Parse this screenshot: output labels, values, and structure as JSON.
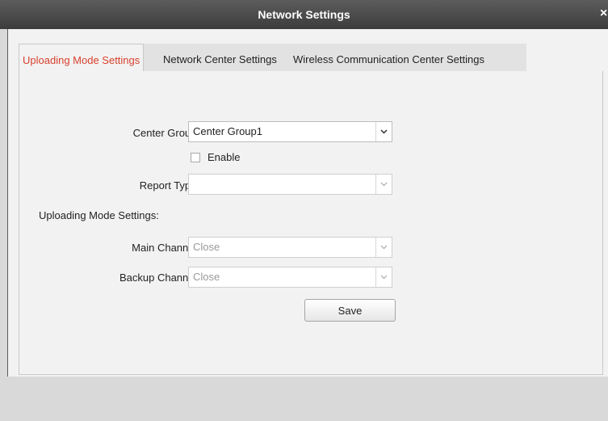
{
  "window": {
    "title": "Network Settings",
    "close_glyph": "×"
  },
  "tabs": [
    {
      "label": "Uploading Mode Settings",
      "active": true
    },
    {
      "label": "Network Center Settings",
      "active": false
    },
    {
      "label": "Wireless Communication Center Settings",
      "active": false
    }
  ],
  "form": {
    "center_group": {
      "label": "Center Group:",
      "value": "Center Group1"
    },
    "enable": {
      "label": "Enable",
      "checked": false
    },
    "report_type": {
      "label": "Report Type:",
      "value": ""
    },
    "section_heading": "Uploading Mode Settings:",
    "main_channel": {
      "label": "Main Channel:",
      "value": "Close"
    },
    "backup_channel": {
      "label": "Backup Channel:",
      "value": "Close"
    },
    "save_label": "Save"
  },
  "colors": {
    "active_tab_text": "#d9412e",
    "titlebar": "#4a4a4a"
  }
}
